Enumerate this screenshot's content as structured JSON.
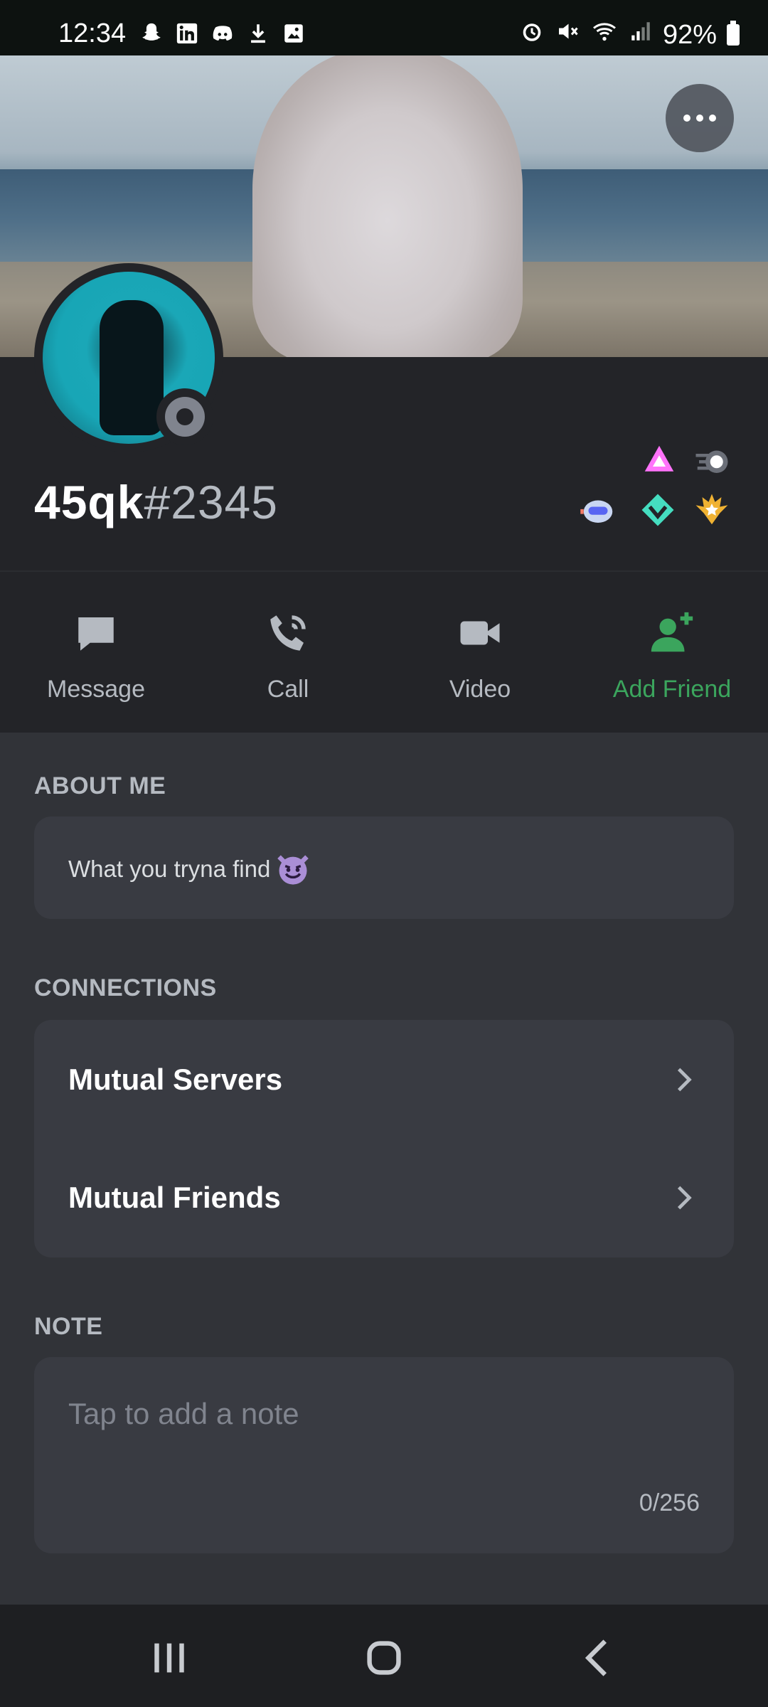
{
  "status_bar": {
    "time": "12:34",
    "battery": "92%",
    "left_icons": [
      "snapchat-icon",
      "linkedin-icon",
      "discord-icon",
      "download-icon",
      "image-icon"
    ],
    "right_icons": [
      "alarm-icon",
      "mute-icon",
      "wifi-icon",
      "signal-icon",
      "battery-icon"
    ]
  },
  "profile": {
    "username": "45qk",
    "discriminator": "#2345",
    "status": "offline",
    "badges": [
      "nitro-boost-badge",
      "nitro-badge",
      "hypesquad-badge",
      "hypesquad-balance-badge",
      "active-developer-badge"
    ]
  },
  "actions": [
    {
      "label": "Message",
      "icon": "message-icon"
    },
    {
      "label": "Call",
      "icon": "call-icon"
    },
    {
      "label": "Video",
      "icon": "video-icon"
    },
    {
      "label": "Add Friend",
      "icon": "add-friend-icon"
    }
  ],
  "about": {
    "title": "ABOUT ME",
    "text": "What you tryna find",
    "emoji": "smiling-imp-emoji"
  },
  "connections": {
    "title": "CONNECTIONS",
    "items": [
      {
        "label": "Mutual Servers"
      },
      {
        "label": "Mutual Friends"
      }
    ]
  },
  "note": {
    "title": "NOTE",
    "placeholder": "Tap to add a note",
    "counter": "0/256"
  },
  "colors": {
    "background": "#313338",
    "header": "#232428",
    "card": "#393b42",
    "accent_green": "#3ba55d"
  }
}
